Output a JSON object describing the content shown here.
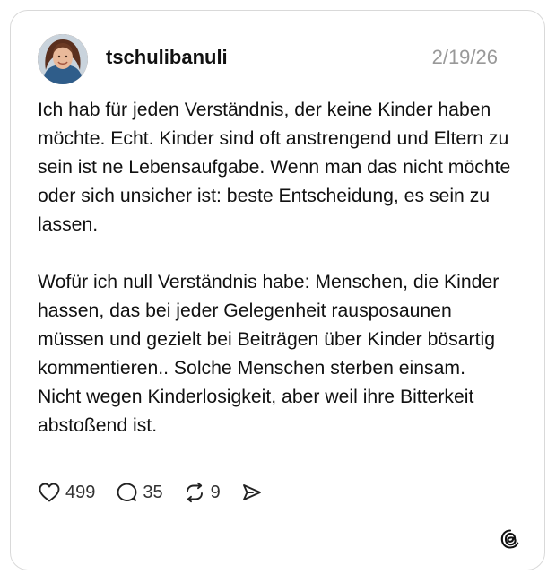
{
  "post": {
    "username": "tschulibanuli",
    "date": "2/19/26",
    "paragraph_1": "Ich hab für jeden Verständnis, der keine Kinder haben möchte. Echt. Kinder sind oft anstrengend und Eltern zu sein ist ne Lebensaufgabe. Wenn man das nicht möchte oder sich unsicher ist: beste Entscheidung, es sein zu lassen.",
    "paragraph_2": "Wofür ich null Verständnis habe: Menschen, die Kinder hassen, das bei jeder Gelegenheit rausposaunen müssen und gezielt bei Beiträgen über Kinder bösartig kommentieren.. Solche Menschen sterben einsam. Nicht wegen Kinderlosigkeit, aber weil ihre Bitterkeit abstoßend ist."
  },
  "actions": {
    "likes": "499",
    "replies": "35",
    "reposts": "9"
  },
  "icons": {
    "like": "heart-icon",
    "reply": "speech-bubble-icon",
    "repost": "repost-icon",
    "share": "send-icon",
    "brand": "threads-logo-icon"
  },
  "colors": {
    "text": "#111111",
    "muted": "#999999",
    "border": "#d9d9d9",
    "background": "#ffffff"
  }
}
